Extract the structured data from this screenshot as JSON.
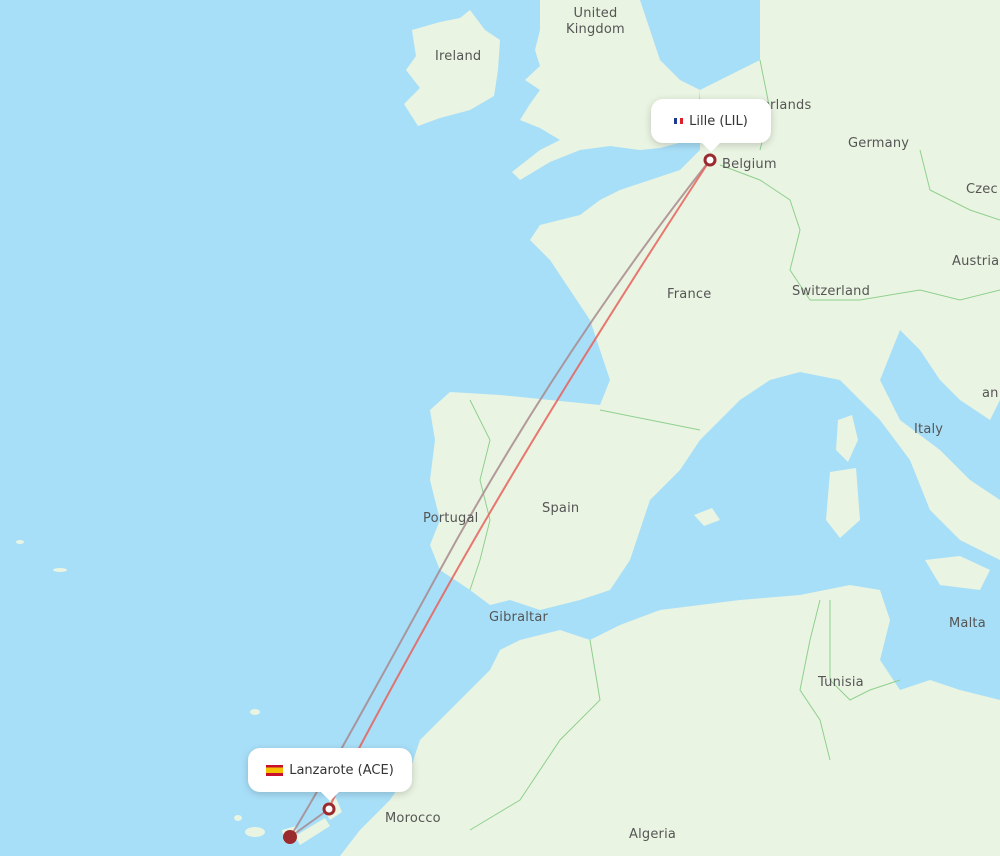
{
  "map": {
    "colors": {
      "water": "#a8dff8",
      "land": "#eaf4e2",
      "border": "#8fd08f",
      "route_primary": "#e8605a",
      "route_secondary": "#a88a8e",
      "marker": "#9b2a2e"
    },
    "country_labels": [
      {
        "id": "united-kingdom",
        "text": "United\nKingdom"
      },
      {
        "id": "ireland",
        "text": "Ireland"
      },
      {
        "id": "netherlands",
        "text": "Netherlands"
      },
      {
        "id": "germany",
        "text": "Germany"
      },
      {
        "id": "belgium",
        "text": "Belgium"
      },
      {
        "id": "czechia",
        "text": "Czec"
      },
      {
        "id": "austria",
        "text": "Austria"
      },
      {
        "id": "france",
        "text": "France"
      },
      {
        "id": "switzerland",
        "text": "Switzerland"
      },
      {
        "id": "italy",
        "text": "Italy"
      },
      {
        "id": "andorra-fragment",
        "text": "an"
      },
      {
        "id": "spain",
        "text": "Spain"
      },
      {
        "id": "portugal",
        "text": "Portugal"
      },
      {
        "id": "gibraltar",
        "text": "Gibraltar"
      },
      {
        "id": "malta",
        "text": "Malta"
      },
      {
        "id": "tunisia",
        "text": "Tunisia"
      },
      {
        "id": "morocco",
        "text": "Morocco"
      },
      {
        "id": "algeria",
        "text": "Algeria"
      }
    ],
    "airports": {
      "origin": {
        "name": "Lille (LIL)",
        "flag": "fr"
      },
      "destination": {
        "name": "Lanzarote (ACE)",
        "flag": "es"
      }
    }
  }
}
